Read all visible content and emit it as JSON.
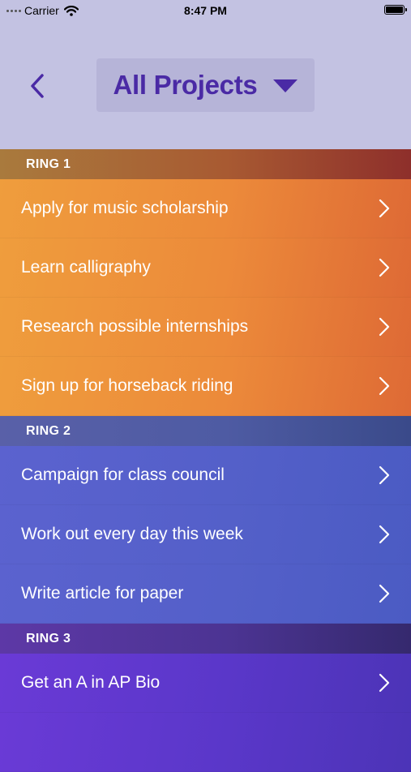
{
  "status_bar": {
    "carrier": "Carrier",
    "time": "8:47 PM"
  },
  "nav": {
    "title": "All Projects"
  },
  "sections": [
    {
      "header": "RING 1",
      "items": [
        "Apply for music scholarship",
        "Learn calligraphy",
        "Research possible internships",
        "Sign up for horseback riding"
      ]
    },
    {
      "header": "RING 2",
      "items": [
        "Campaign for class council",
        "Work out every day this week",
        "Write article for paper"
      ]
    },
    {
      "header": "RING 3",
      "items": [
        "Get an A in AP Bio"
      ]
    }
  ],
  "colors": {
    "background": "#c3c2e2",
    "title_accent": "#4a2aa5",
    "ring_1_row": "#ec8a3a",
    "ring_2_row": "#5460c9",
    "ring_3_row": "#5a37c9"
  }
}
